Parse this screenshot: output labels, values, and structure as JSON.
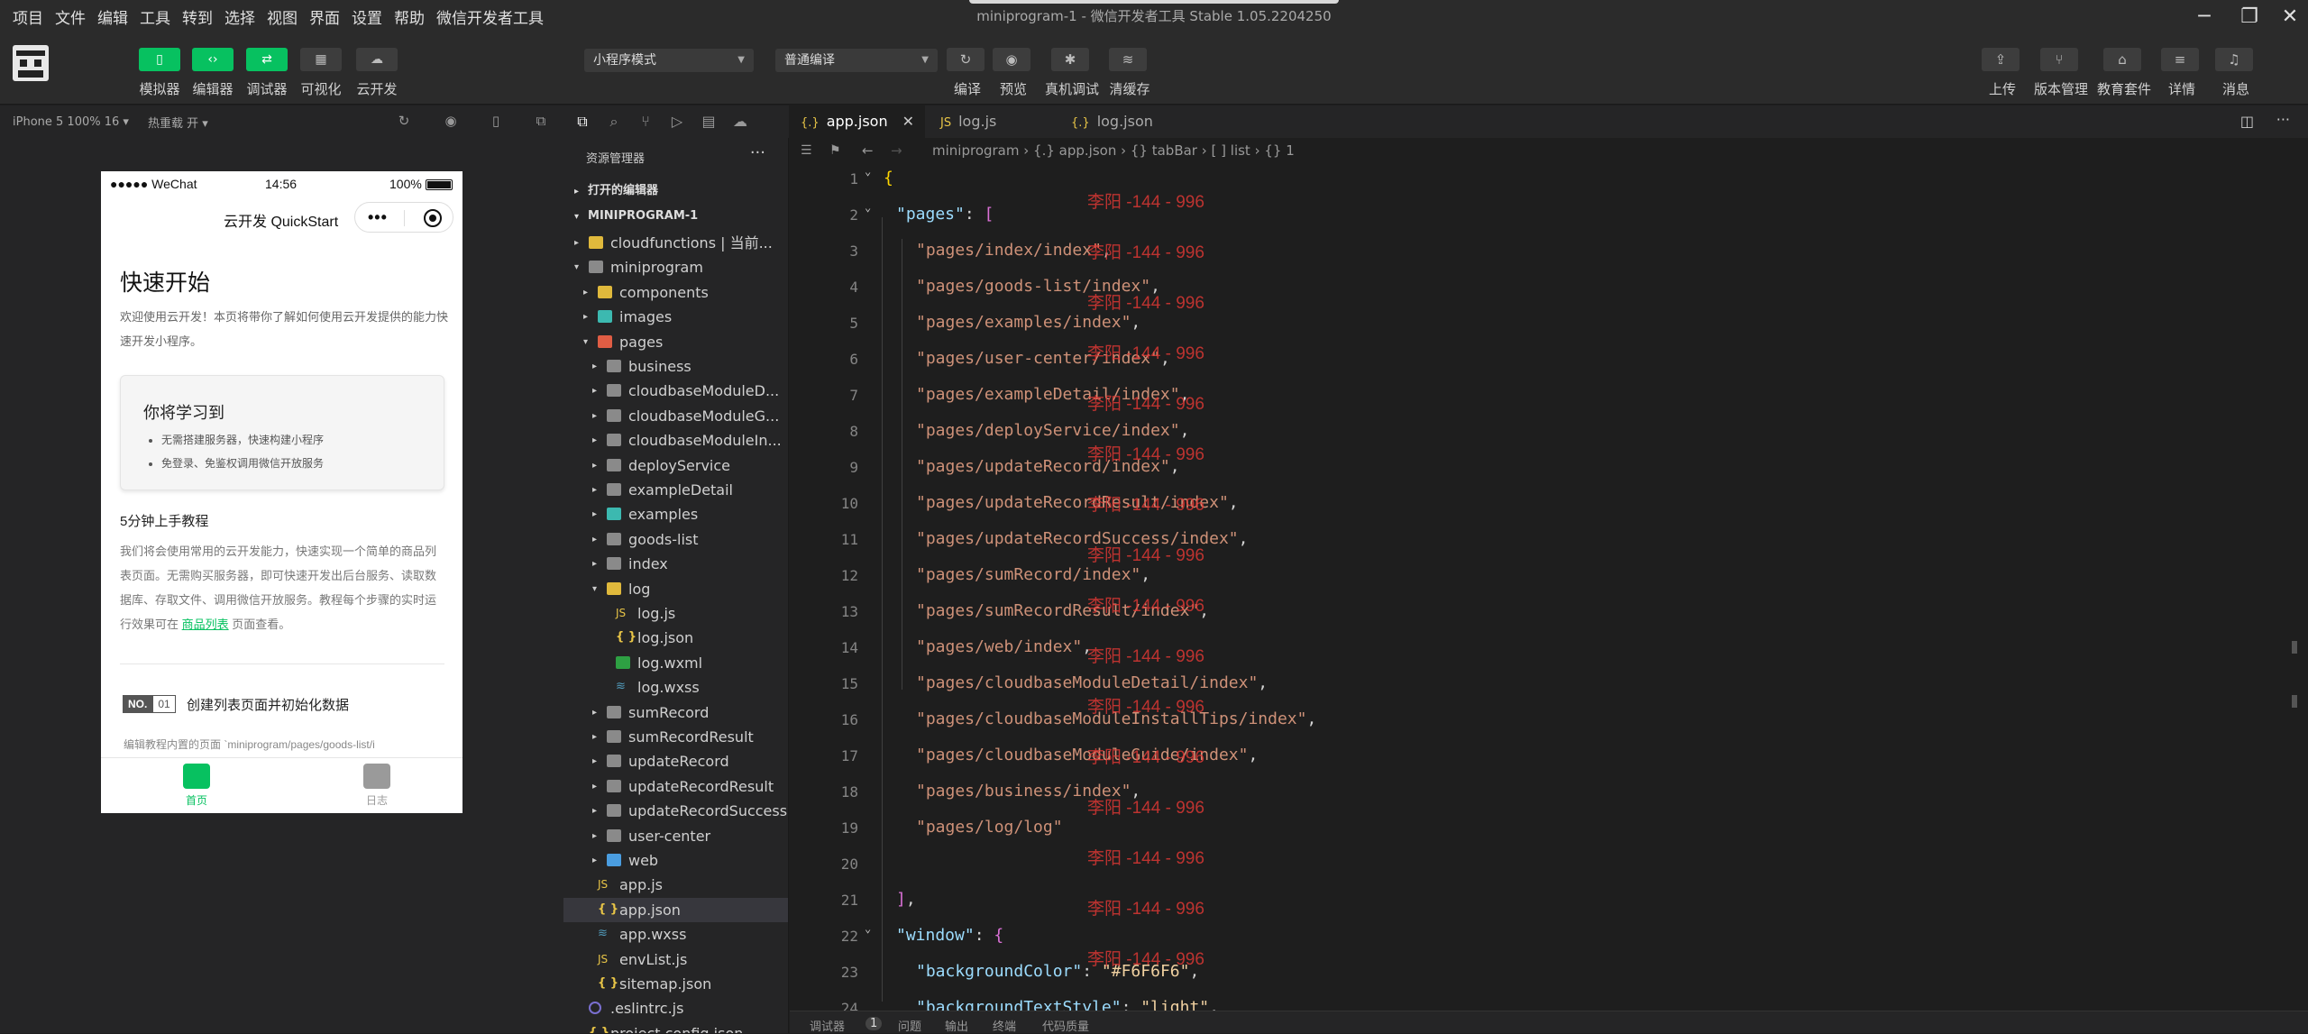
{
  "menu": [
    "项目",
    "文件",
    "编辑",
    "工具",
    "转到",
    "选择",
    "视图",
    "界面",
    "设置",
    "帮助",
    "微信开发者工具"
  ],
  "window_title": "miniprogram-1 - 微信开发者工具 Stable 1.05.2204250",
  "window_controls": [
    "minimize-icon",
    "restore-icon",
    "close-icon"
  ],
  "toolbar": {
    "left_buttons": [
      {
        "label": "模拟器",
        "icon": "phone-icon"
      },
      {
        "label": "编辑器",
        "icon": "code-icon"
      },
      {
        "label": "调试器",
        "icon": "sliders-icon"
      },
      {
        "label": "可视化",
        "icon": "layout-icon"
      },
      {
        "label": "云开发",
        "icon": "cloud-icon"
      }
    ],
    "mode_select": "小程序模式",
    "compile_select": "普通编译",
    "mid_buttons": [
      {
        "label": "编译",
        "icon": "refresh-icon"
      },
      {
        "label": "预览",
        "icon": "eye-icon"
      },
      {
        "label": "真机调试",
        "icon": "bug-icon"
      },
      {
        "label": "清缓存",
        "icon": "layers-icon"
      }
    ],
    "right_buttons": [
      {
        "label": "上传",
        "icon": "upload-icon"
      },
      {
        "label": "版本管理",
        "icon": "branch-icon"
      },
      {
        "label": "教育套件",
        "icon": "graduation-icon"
      },
      {
        "label": "详情",
        "icon": "menu-icon"
      },
      {
        "label": "消息",
        "icon": "bell-icon"
      }
    ]
  },
  "simulator": {
    "device": "iPhone 5 100% 16 ▾",
    "hot_reload": "热重载 开 ▾",
    "status_bar": {
      "carrier": "●●●●● WeChat",
      "time": "14:56",
      "battery": "100%"
    },
    "nav_title": "云开发 QuickStart",
    "page": {
      "heading": "快速开始",
      "intro": "欢迎使用云开发！本页将带你了解如何使用云开发提供的能力快速开发小程序。",
      "learn_title": "你将学习到",
      "learn_items": [
        "无需搭建服务器，快速构建小程序",
        "免登录、免鉴权调用微信开放服务"
      ],
      "tutorial_title": "5分钟上手教程",
      "tutorial_text_before": "我们将会使用常用的云开发能力，快速实现一个简单的商品列表页面。无需购买服务器，即可快速开发出后台服务、读取数据库、存取文件、调用微信开放服务。教程每个步骤的实时运行效果可在 ",
      "tutorial_link": "商品列表",
      "tutorial_text_after": " 页面查看。",
      "step_no_prefix": "NO.",
      "step_no": "01",
      "step_title": "创建列表页面并初始化数据",
      "step_text": "编辑教程内置的页面 `miniprogram/pages/goods-list/i"
    },
    "tabs": [
      {
        "label": "首页",
        "color": "#07c160"
      },
      {
        "label": "日志",
        "color": "#999999"
      }
    ]
  },
  "explorer": {
    "title": "资源管理器",
    "open_editors": "打开的编辑器",
    "project": "MINIPROGRAM-1",
    "tree": [
      {
        "label": "cloudfunctions | 当前...",
        "depth": 1,
        "type": "folder-y",
        "twisty": "▸"
      },
      {
        "label": "miniprogram",
        "depth": 1,
        "type": "folder",
        "twisty": "▾"
      },
      {
        "label": "components",
        "depth": 2,
        "type": "folder-y",
        "twisty": "▸"
      },
      {
        "label": "images",
        "depth": 2,
        "type": "folder-c",
        "twisty": "▸"
      },
      {
        "label": "pages",
        "depth": 2,
        "type": "folder-r",
        "twisty": "▾"
      },
      {
        "label": "business",
        "depth": 3,
        "type": "folder",
        "twisty": "▸"
      },
      {
        "label": "cloudbaseModuleD...",
        "depth": 3,
        "type": "folder",
        "twisty": "▸"
      },
      {
        "label": "cloudbaseModuleG...",
        "depth": 3,
        "type": "folder",
        "twisty": "▸"
      },
      {
        "label": "cloudbaseModuleIn...",
        "depth": 3,
        "type": "folder",
        "twisty": "▸"
      },
      {
        "label": "deployService",
        "depth": 3,
        "type": "folder",
        "twisty": "▸"
      },
      {
        "label": "exampleDetail",
        "depth": 3,
        "type": "folder",
        "twisty": "▸"
      },
      {
        "label": "examples",
        "depth": 3,
        "type": "folder-c",
        "twisty": "▸"
      },
      {
        "label": "goods-list",
        "depth": 3,
        "type": "folder",
        "twisty": "▸"
      },
      {
        "label": "index",
        "depth": 3,
        "type": "folder",
        "twisty": "▸"
      },
      {
        "label": "log",
        "depth": 3,
        "type": "folder-y",
        "twisty": "▾"
      },
      {
        "label": "log.js",
        "depth": 4,
        "type": "js",
        "twisty": ""
      },
      {
        "label": "log.json",
        "depth": 4,
        "type": "json",
        "twisty": ""
      },
      {
        "label": "log.wxml",
        "depth": 4,
        "type": "wxml",
        "twisty": ""
      },
      {
        "label": "log.wxss",
        "depth": 4,
        "type": "wxss",
        "twisty": ""
      },
      {
        "label": "sumRecord",
        "depth": 3,
        "type": "folder",
        "twisty": "▸"
      },
      {
        "label": "sumRecordResult",
        "depth": 3,
        "type": "folder",
        "twisty": "▸"
      },
      {
        "label": "updateRecord",
        "depth": 3,
        "type": "folder",
        "twisty": "▸"
      },
      {
        "label": "updateRecordResult",
        "depth": 3,
        "type": "folder",
        "twisty": "▸"
      },
      {
        "label": "updateRecordSuccess",
        "depth": 3,
        "type": "folder",
        "twisty": "▸"
      },
      {
        "label": "user-center",
        "depth": 3,
        "type": "folder",
        "twisty": "▸"
      },
      {
        "label": "web",
        "depth": 3,
        "type": "folder-b",
        "twisty": "▸"
      },
      {
        "label": "app.js",
        "depth": 2,
        "type": "js",
        "twisty": ""
      },
      {
        "label": "app.json",
        "depth": 2,
        "type": "json",
        "twisty": "",
        "selected": true
      },
      {
        "label": "app.wxss",
        "depth": 2,
        "type": "wxss",
        "twisty": ""
      },
      {
        "label": "envList.js",
        "depth": 2,
        "type": "js",
        "twisty": ""
      },
      {
        "label": "sitemap.json",
        "depth": 2,
        "type": "json",
        "twisty": ""
      },
      {
        "label": ".eslintrc.js",
        "depth": 1,
        "type": "eslint",
        "twisty": ""
      },
      {
        "label": "project.config.json",
        "depth": 1,
        "type": "json",
        "twisty": ""
      }
    ]
  },
  "editor": {
    "tabs": [
      {
        "label": "app.json",
        "active": true
      },
      {
        "label": "log.js",
        "active": false
      },
      {
        "label": "log.json",
        "active": false
      }
    ],
    "breadcrumb": [
      "miniprogram",
      "{.} app.json",
      "{} tabBar",
      "[ ] list",
      "{} 1"
    ],
    "lines": [
      {
        "n": 1,
        "indent": 0,
        "parts": [
          [
            "{",
            "y"
          ]
        ],
        "fold": true
      },
      {
        "n": 2,
        "indent": 1,
        "parts": [
          [
            "\"pages\"",
            "key"
          ],
          [
            ": ",
            "c"
          ],
          [
            "[",
            "p"
          ]
        ],
        "fold": true
      },
      {
        "n": 3,
        "indent": 2,
        "parts": [
          [
            "\"pages/index/index\"",
            "str"
          ],
          [
            ",",
            "c"
          ]
        ]
      },
      {
        "n": 4,
        "indent": 2,
        "parts": [
          [
            "\"pages/goods-list/index\"",
            "str"
          ],
          [
            ",",
            "c"
          ]
        ]
      },
      {
        "n": 5,
        "indent": 2,
        "parts": [
          [
            "\"pages/examples/index\"",
            "str"
          ],
          [
            ",",
            "c"
          ]
        ]
      },
      {
        "n": 6,
        "indent": 2,
        "parts": [
          [
            "\"pages/user-center/index\"",
            "str"
          ],
          [
            ",",
            "c"
          ]
        ]
      },
      {
        "n": 7,
        "indent": 2,
        "parts": [
          [
            "\"pages/exampleDetail/index\"",
            "str"
          ],
          [
            ",",
            "c"
          ]
        ]
      },
      {
        "n": 8,
        "indent": 2,
        "parts": [
          [
            "\"pages/deployService/index\"",
            "str"
          ],
          [
            ",",
            "c"
          ]
        ]
      },
      {
        "n": 9,
        "indent": 2,
        "parts": [
          [
            "\"pages/updateRecord/index\"",
            "str"
          ],
          [
            ",",
            "c"
          ]
        ]
      },
      {
        "n": 10,
        "indent": 2,
        "parts": [
          [
            "\"pages/updateRecordResult/index\"",
            "str"
          ],
          [
            ",",
            "c"
          ]
        ]
      },
      {
        "n": 11,
        "indent": 2,
        "parts": [
          [
            "\"pages/updateRecordSuccess/index\"",
            "str"
          ],
          [
            ",",
            "c"
          ]
        ]
      },
      {
        "n": 12,
        "indent": 2,
        "parts": [
          [
            "\"pages/sumRecord/index\"",
            "str"
          ],
          [
            ",",
            "c"
          ]
        ]
      },
      {
        "n": 13,
        "indent": 2,
        "parts": [
          [
            "\"pages/sumRecordResult/index\"",
            "str"
          ],
          [
            ",",
            "c"
          ]
        ]
      },
      {
        "n": 14,
        "indent": 2,
        "parts": [
          [
            "\"pages/web/index\"",
            "str"
          ],
          [
            ",",
            "c"
          ]
        ]
      },
      {
        "n": 15,
        "indent": 2,
        "parts": [
          [
            "\"pages/cloudbaseModuleDetail/index\"",
            "str"
          ],
          [
            ",",
            "c"
          ]
        ]
      },
      {
        "n": 16,
        "indent": 2,
        "parts": [
          [
            "\"pages/cloudbaseModuleInstallTips/index\"",
            "str"
          ],
          [
            ",",
            "c"
          ]
        ]
      },
      {
        "n": 17,
        "indent": 2,
        "parts": [
          [
            "\"pages/cloudbaseModuleGuide/index\"",
            "str"
          ],
          [
            ",",
            "c"
          ]
        ]
      },
      {
        "n": 18,
        "indent": 2,
        "parts": [
          [
            "\"pages/business/index\"",
            "str"
          ],
          [
            ",",
            "c"
          ]
        ]
      },
      {
        "n": 19,
        "indent": 2,
        "parts": [
          [
            "\"pages/log/log\"",
            "str"
          ]
        ]
      },
      {
        "n": 20,
        "indent": 0,
        "parts": []
      },
      {
        "n": 21,
        "indent": 1,
        "parts": [
          [
            "]",
            "p"
          ],
          [
            ",",
            "c"
          ]
        ]
      },
      {
        "n": 22,
        "indent": 1,
        "parts": [
          [
            "\"window\"",
            "key"
          ],
          [
            ": ",
            "c"
          ],
          [
            "{",
            "p"
          ]
        ],
        "fold": true
      },
      {
        "n": 23,
        "indent": 2,
        "parts": [
          [
            "\"backgroundColor\"",
            "key"
          ],
          [
            ": ",
            "c"
          ],
          [
            "\"#F6F6F6\"",
            "str2"
          ],
          [
            ",",
            "c"
          ]
        ]
      },
      {
        "n": 24,
        "indent": 2,
        "parts": [
          [
            "\"backgroundTextStyle\"",
            "key"
          ],
          [
            ": ",
            "c"
          ],
          [
            "\"light\"",
            "str2"
          ],
          [
            ",",
            "c"
          ]
        ]
      }
    ],
    "watermark": "李阳 -144 - 996"
  },
  "bottom_panel": [
    "调试器",
    "1",
    "问题",
    "输出",
    "终端",
    "代码质量"
  ]
}
